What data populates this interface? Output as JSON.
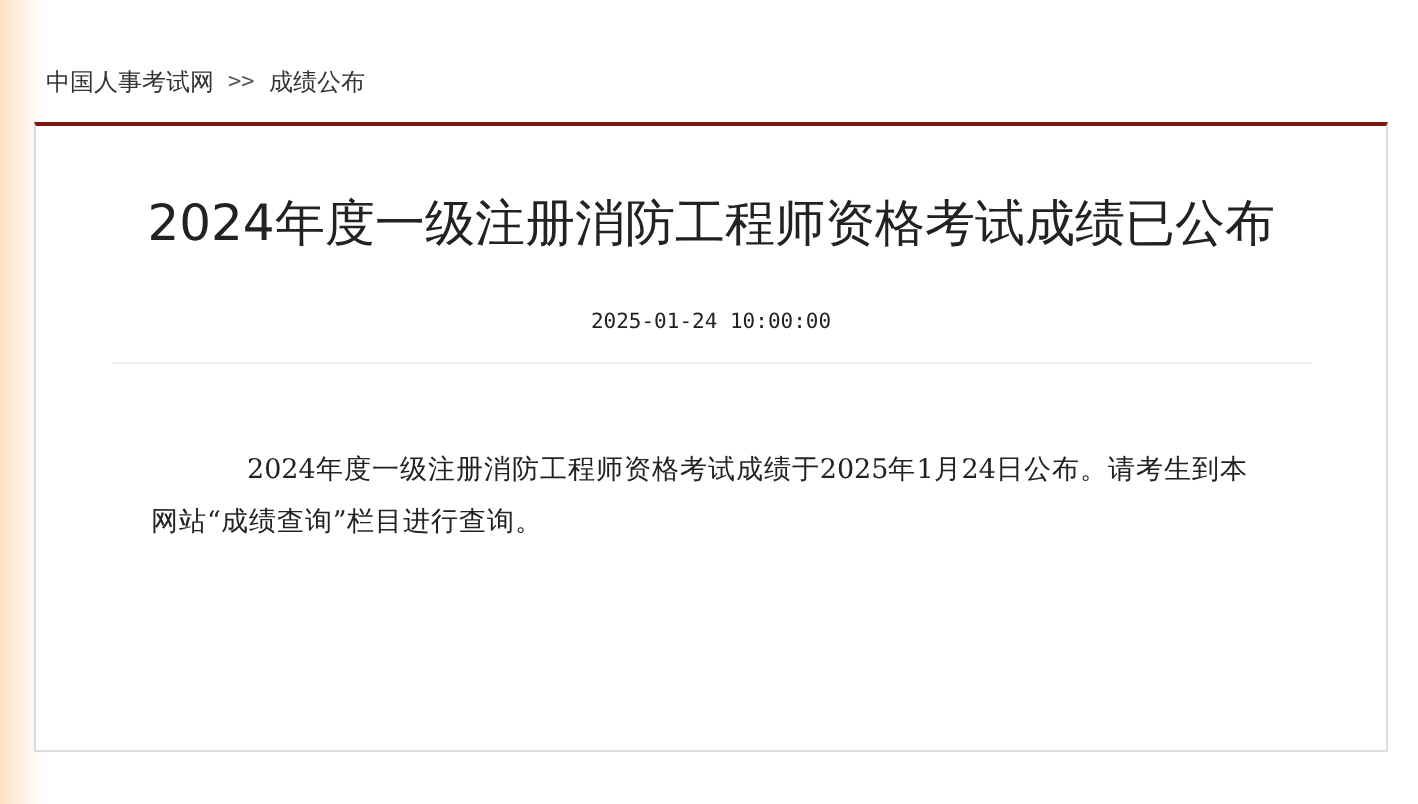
{
  "breadcrumb": [
    {
      "kind": "link",
      "text": "中国人事考试网"
    },
    {
      "kind": "separator",
      "text": ">>"
    },
    {
      "kind": "link",
      "text": "成绩公布"
    }
  ],
  "article": {
    "title": "2024年度一级注册消防工程师资格考试成绩已公布",
    "date": "2025-01-24 10:00:00",
    "paragraph": "2024年度一级注册消防工程师资格考试成绩于2025年1月24日公布。请考生到本网站“成绩查询”栏目进行查询。"
  }
}
